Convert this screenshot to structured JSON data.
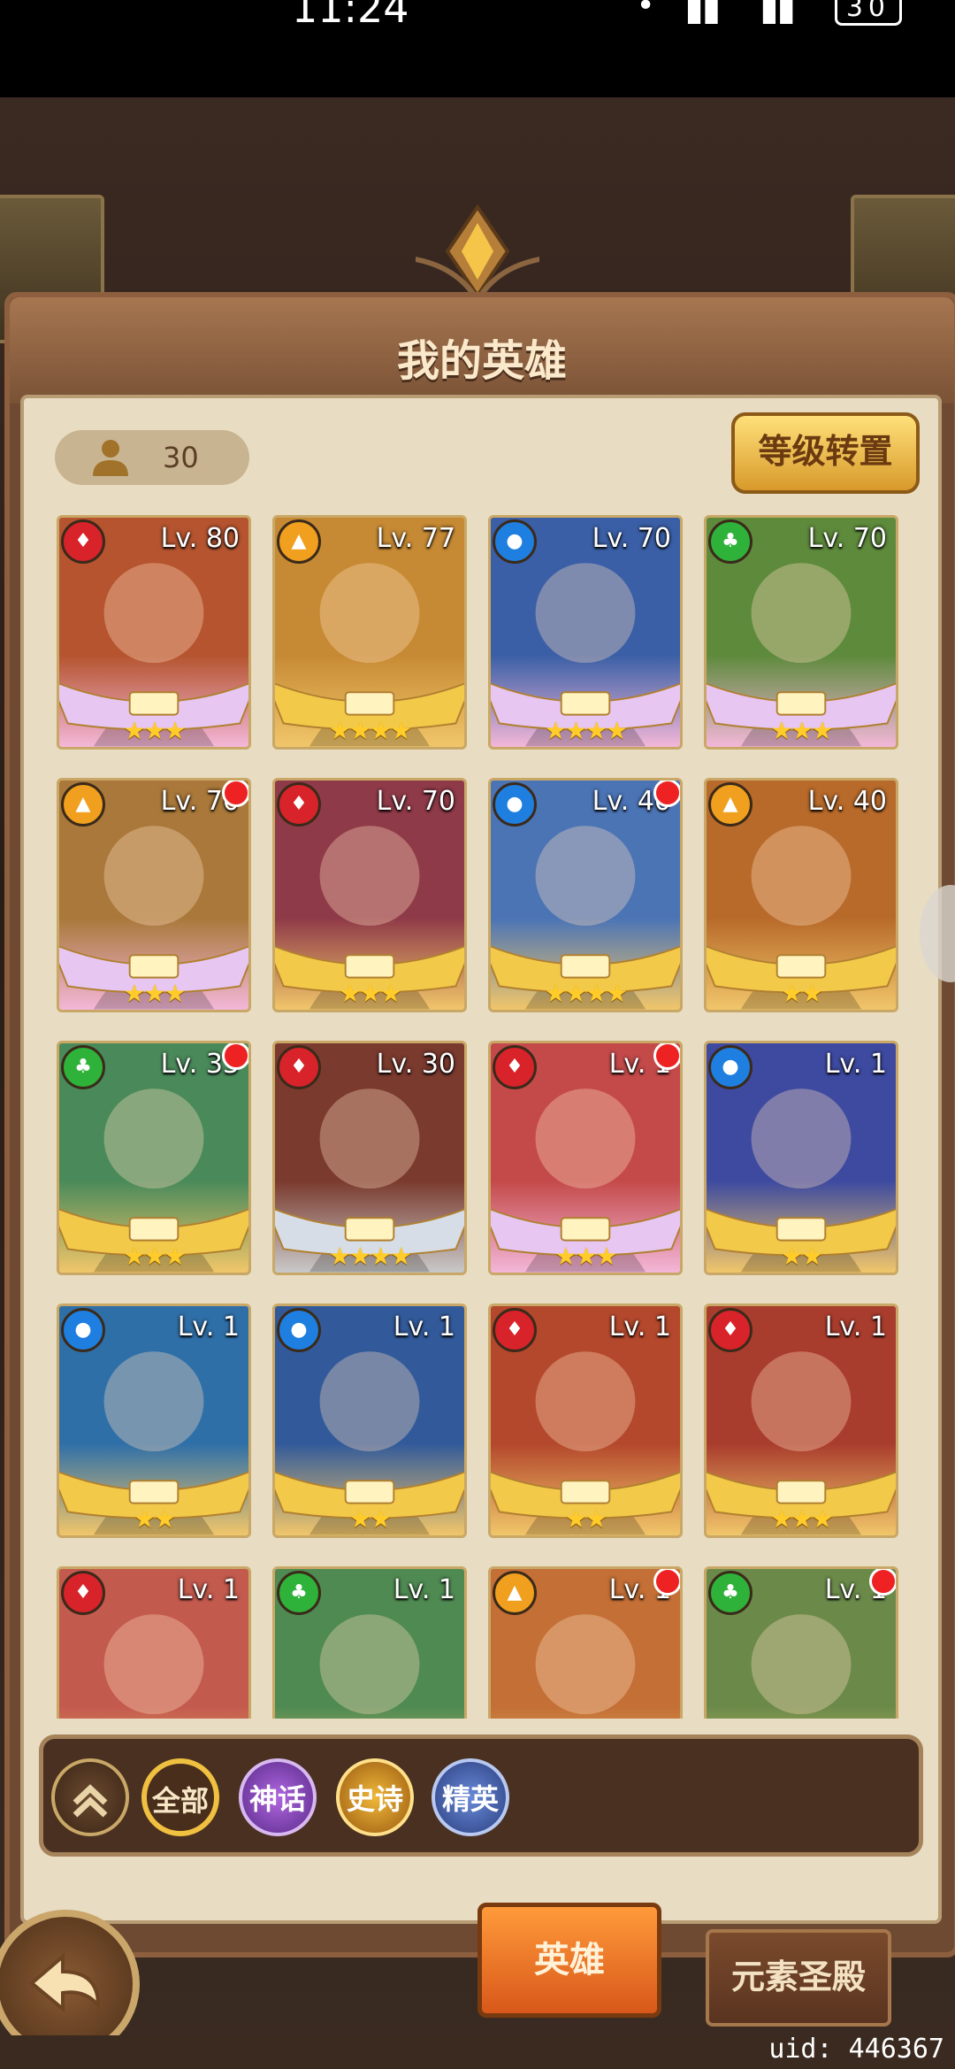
{
  "status_bar": {
    "time": "11:24",
    "signal": "• ▐▌ ▐▌",
    "battery": "30"
  },
  "panel": {
    "title": "我的英雄",
    "hero_count": "30",
    "transfer_button": "等级转置"
  },
  "colors": {
    "fire": "#d8232a",
    "water": "#1e7fe0",
    "earth": "#f0a01e",
    "nature": "#2fb23a"
  },
  "heroes": [
    {
      "level": "Lv. 80",
      "element": "fire",
      "stars": "★★★",
      "bg": "#b5542f",
      "rarity": "mythic",
      "new": false
    },
    {
      "level": "Lv. 77",
      "element": "earth",
      "stars": "★★★★",
      "bg": "#c78a34",
      "rarity": "epic",
      "new": false
    },
    {
      "level": "Lv. 70",
      "element": "water",
      "stars": "★★★★",
      "bg": "#3a5fa6",
      "rarity": "mythic",
      "new": false
    },
    {
      "level": "Lv. 70",
      "element": "nature",
      "stars": "★★★",
      "bg": "#5e8a3c",
      "rarity": "mythic",
      "new": false
    },
    {
      "level": "Lv. 70",
      "element": "earth",
      "stars": "★★★",
      "bg": "#a9783a",
      "rarity": "mythic",
      "new": true
    },
    {
      "level": "Lv. 70",
      "element": "fire",
      "stars": "★★★",
      "bg": "#8f3a48",
      "rarity": "epic",
      "new": false
    },
    {
      "level": "Lv. 40",
      "element": "water",
      "stars": "★★★★",
      "bg": "#4b74b5",
      "rarity": "epic",
      "new": true
    },
    {
      "level": "Lv. 40",
      "element": "earth",
      "stars": "★★",
      "bg": "#b86a2a",
      "rarity": "epic",
      "new": false
    },
    {
      "level": "Lv. 33",
      "element": "nature",
      "stars": "★★★",
      "bg": "#4a8a5a",
      "rarity": "epic",
      "new": true
    },
    {
      "level": "Lv. 30",
      "element": "fire",
      "stars": "★★★★",
      "bg": "#7a3a2e",
      "rarity": "elite",
      "new": false
    },
    {
      "level": "Lv. 1",
      "element": "fire",
      "stars": "★★★",
      "bg": "#c44a4a",
      "rarity": "mythic",
      "new": true
    },
    {
      "level": "Lv. 1",
      "element": "water",
      "stars": "★★",
      "bg": "#3d4aa0",
      "rarity": "epic",
      "new": false
    },
    {
      "level": "Lv. 1",
      "element": "water",
      "stars": "★★",
      "bg": "#2f6fa8",
      "rarity": "epic",
      "new": false
    },
    {
      "level": "Lv. 1",
      "element": "water",
      "stars": "★★",
      "bg": "#325a9a",
      "rarity": "epic",
      "new": false
    },
    {
      "level": "Lv. 1",
      "element": "fire",
      "stars": "★★",
      "bg": "#b4482c",
      "rarity": "epic",
      "new": false
    },
    {
      "level": "Lv. 1",
      "element": "fire",
      "stars": "★★★",
      "bg": "#a93d2d",
      "rarity": "epic",
      "new": false
    },
    {
      "level": "Lv. 1",
      "element": "fire",
      "stars": "",
      "bg": "#c35a4e",
      "rarity": "epic",
      "new": false
    },
    {
      "level": "Lv. 1",
      "element": "nature",
      "stars": "",
      "bg": "#4f8a52",
      "rarity": "epic",
      "new": false
    },
    {
      "level": "Lv. 1",
      "element": "earth",
      "stars": "",
      "bg": "#c36f36",
      "rarity": "epic",
      "new": true
    },
    {
      "level": "Lv. 1",
      "element": "nature",
      "stars": "",
      "bg": "#6b8a4a",
      "rarity": "epic",
      "new": true
    }
  ],
  "filters": {
    "all": "全部",
    "mythic": "神话",
    "epic": "史诗",
    "elite": "精英"
  },
  "bottom_tabs": {
    "heroes": "英雄",
    "element_shrine": "元素圣殿"
  },
  "uid": "uid: 446367"
}
